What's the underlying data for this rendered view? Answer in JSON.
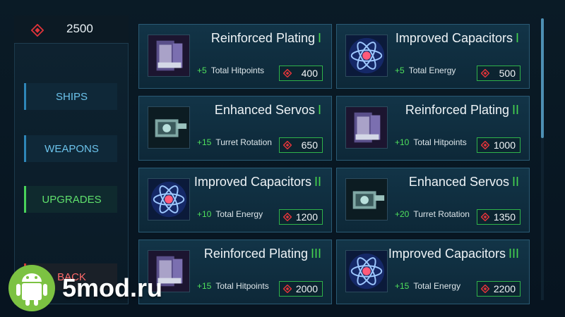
{
  "currency": {
    "icon": "red-diamond-gem-icon",
    "amount": "2500"
  },
  "nav": {
    "ships": "SHIPS",
    "weapons": "WEAPONS",
    "upgrades": "UPGRADES",
    "back": "BACK"
  },
  "cards": [
    {
      "name": "Reinforced Plating",
      "tier": "I",
      "bonus": "+5",
      "stat": "Total Hitpoints",
      "cost": "400",
      "icon": "armor-plating-icon"
    },
    {
      "name": "Improved Capacitors",
      "tier": "I",
      "bonus": "+5",
      "stat": "Total Energy",
      "cost": "500",
      "icon": "atom-energy-icon"
    },
    {
      "name": "Enhanced Servos",
      "tier": "I",
      "bonus": "+15",
      "stat": "Turret Rotation",
      "cost": "650",
      "icon": "servo-turret-icon"
    },
    {
      "name": "Reinforced Plating",
      "tier": "II",
      "bonus": "+10",
      "stat": "Total Hitpoints",
      "cost": "1000",
      "icon": "armor-plating-icon"
    },
    {
      "name": "Improved Capacitors",
      "tier": "II",
      "bonus": "+10",
      "stat": "Total Energy",
      "cost": "1200",
      "icon": "atom-energy-icon"
    },
    {
      "name": "Enhanced Servos",
      "tier": "II",
      "bonus": "+20",
      "stat": "Turret Rotation",
      "cost": "1350",
      "icon": "servo-turret-icon"
    },
    {
      "name": "Reinforced Plating",
      "tier": "III",
      "bonus": "+15",
      "stat": "Total Hitpoints",
      "cost": "2000",
      "icon": "armor-plating-icon"
    },
    {
      "name": "Improved Capacitors",
      "tier": "III",
      "bonus": "+15",
      "stat": "Total Energy",
      "cost": "2200",
      "icon": "atom-energy-icon"
    }
  ],
  "watermark": {
    "text": "5mod.ru"
  },
  "colors": {
    "accent_green": "#45d24f",
    "accent_blue": "#6bc2ea",
    "currency_red": "#e0343a"
  }
}
